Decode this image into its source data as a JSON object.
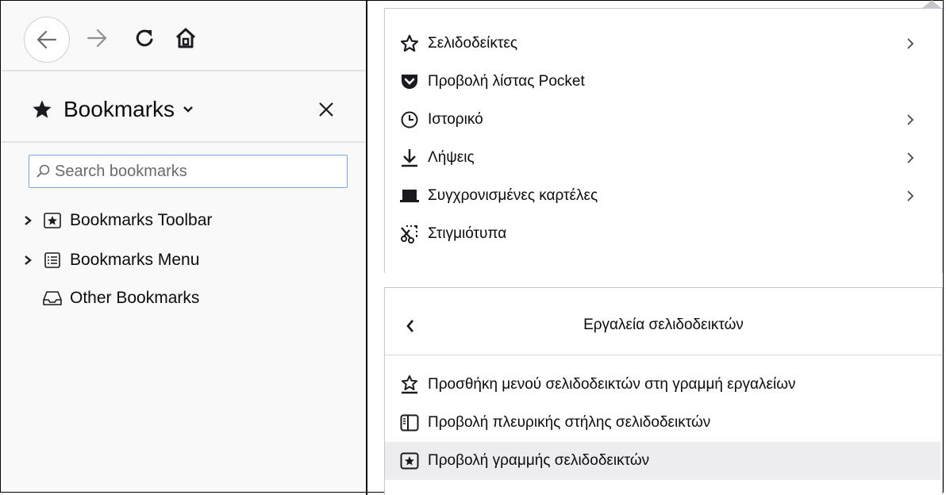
{
  "sidebar": {
    "title": "Bookmarks",
    "search_placeholder": "Search bookmarks",
    "items": [
      {
        "label": "Bookmarks Toolbar",
        "expandable": true,
        "icon": "bookmark-toolbar-icon"
      },
      {
        "label": "Bookmarks Menu",
        "expandable": true,
        "icon": "bookmark-menu-icon"
      },
      {
        "label": "Other Bookmarks",
        "expandable": false,
        "icon": "folder-icon"
      }
    ]
  },
  "main_menu": {
    "items": [
      {
        "label": "Σελιδοδείκτες",
        "icon": "star-outline-icon",
        "submenu": true
      },
      {
        "label": "Προβολή λίστας Pocket",
        "icon": "pocket-icon",
        "submenu": false
      },
      {
        "label": "Ιστορικό",
        "icon": "clock-icon",
        "submenu": true
      },
      {
        "label": "Λήψεις",
        "icon": "download-icon",
        "submenu": true
      },
      {
        "label": "Συγχρονισμένες καρτέλες",
        "icon": "synced-tabs-icon",
        "submenu": true
      },
      {
        "label": "Στιγμιότυπα",
        "icon": "screenshot-icon",
        "submenu": false
      }
    ]
  },
  "bookmarks_submenu": {
    "title": "Εργαλεία σελιδοδεικτών",
    "items": [
      {
        "label": "Προσθήκη μενού σελιδοδεικτών στη γραμμή εργαλείων",
        "icon": "add-menu-to-toolbar-icon",
        "highlighted": false
      },
      {
        "label": "Προβολή πλευρικής στήλης σελιδοδεικτών",
        "icon": "sidebar-icon",
        "highlighted": false
      },
      {
        "label": "Προβολή γραμμής σελιδοδεικτών",
        "icon": "bookmarks-toolbar-icon",
        "highlighted": true
      }
    ]
  },
  "colors": {
    "highlight": "#ededf0",
    "border": "#c7c7cc",
    "search_focus": "#7ea6d8"
  }
}
